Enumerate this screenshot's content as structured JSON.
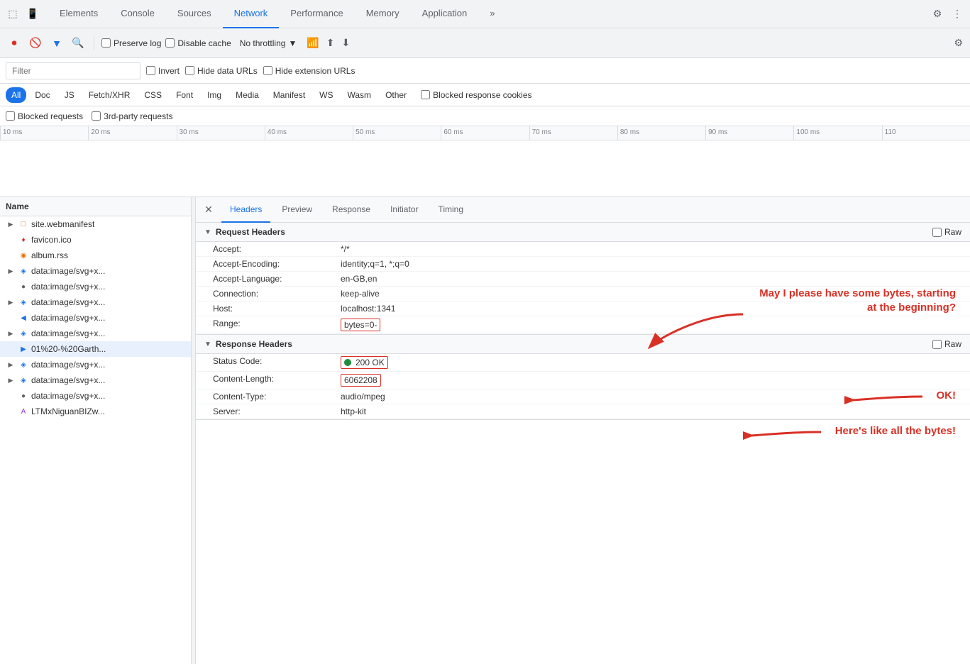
{
  "tabs": {
    "items": [
      {
        "label": "Elements",
        "active": false
      },
      {
        "label": "Console",
        "active": false
      },
      {
        "label": "Sources",
        "active": false
      },
      {
        "label": "Network",
        "active": true
      },
      {
        "label": "Performance",
        "active": false
      },
      {
        "label": "Memory",
        "active": false
      },
      {
        "label": "Application",
        "active": false
      },
      {
        "label": "»",
        "active": false
      }
    ]
  },
  "toolbar": {
    "preserve_log": "Preserve log",
    "disable_cache": "Disable cache",
    "no_throttling": "No throttling"
  },
  "filter_bar": {
    "placeholder": "Filter",
    "invert": "Invert",
    "hide_data_urls": "Hide data URLs",
    "hide_ext_urls": "Hide extension URLs"
  },
  "type_buttons": [
    "All",
    "Doc",
    "JS",
    "Fetch/XHR",
    "CSS",
    "Font",
    "Img",
    "Media",
    "Manifest",
    "WS",
    "Wasm",
    "Other"
  ],
  "blocked_response_cookies": "Blocked response cookies",
  "extra_filters": {
    "blocked_requests": "Blocked requests",
    "third_party": "3rd-party requests"
  },
  "timeline": {
    "ticks": [
      "10 ms",
      "20 ms",
      "30 ms",
      "40 ms",
      "50 ms",
      "60 ms",
      "70 ms",
      "80 ms",
      "90 ms",
      "100 ms",
      "110"
    ]
  },
  "file_list": {
    "header": "Name",
    "items": [
      {
        "name": "site.webmanifest",
        "icon": "html",
        "expand": false,
        "selected": false
      },
      {
        "name": "favicon.ico",
        "icon": "ico",
        "expand": false,
        "selected": false
      },
      {
        "name": "album.rss",
        "icon": "rss",
        "expand": false,
        "selected": false
      },
      {
        "name": "data:image/svg+x...",
        "icon": "svg",
        "expand": true,
        "selected": false
      },
      {
        "name": "data:image/svg+x...",
        "icon": "dot",
        "expand": false,
        "selected": false
      },
      {
        "name": "data:image/svg+x...",
        "icon": "svg",
        "expand": true,
        "selected": false
      },
      {
        "name": "data:image/svg+x...",
        "icon": "audio",
        "expand": false,
        "selected": false
      },
      {
        "name": "data:image/svg+x...",
        "icon": "svg",
        "expand": true,
        "selected": false
      },
      {
        "name": "01%20-%20Garth...",
        "icon": "audio",
        "expand": false,
        "selected": true
      },
      {
        "name": "data:image/svg+x...",
        "icon": "svg",
        "expand": true,
        "selected": false
      },
      {
        "name": "data:image/svg+x...",
        "icon": "svg",
        "expand": true,
        "selected": false
      },
      {
        "name": "data:image/svg+x...",
        "icon": "dot",
        "expand": false,
        "selected": false
      },
      {
        "name": "LTMxNiguanBIZw...",
        "icon": "font",
        "expand": false,
        "selected": false
      }
    ]
  },
  "detail": {
    "tabs": [
      "Headers",
      "Preview",
      "Response",
      "Initiator",
      "Timing"
    ],
    "active_tab": "Headers",
    "request_headers": {
      "title": "Request Headers",
      "raw_label": "Raw",
      "rows": [
        {
          "name": "Accept:",
          "value": "*/*"
        },
        {
          "name": "Accept-Encoding:",
          "value": "identity;q=1, *;q=0"
        },
        {
          "name": "Accept-Language:",
          "value": "en-GB,en"
        },
        {
          "name": "Connection:",
          "value": "keep-alive"
        },
        {
          "name": "Host:",
          "value": "localhost:1341"
        },
        {
          "name": "Range:",
          "value": "bytes=0-",
          "highlighted": true
        }
      ]
    },
    "response_headers": {
      "title": "Response Headers",
      "raw_label": "Raw",
      "rows": [
        {
          "name": "Status Code:",
          "value": "200 OK",
          "status": true,
          "highlighted": true
        },
        {
          "name": "Content-Length:",
          "value": "6062208",
          "highlighted": true
        },
        {
          "name": "Content-Type:",
          "value": "audio/mpeg"
        },
        {
          "name": "Server:",
          "value": "http-kit"
        }
      ]
    }
  },
  "annotations": {
    "arrow1": "May I please have some bytes, starting at the beginning?",
    "arrow2": "OK!",
    "arrow3": "Here's like all the bytes!"
  }
}
